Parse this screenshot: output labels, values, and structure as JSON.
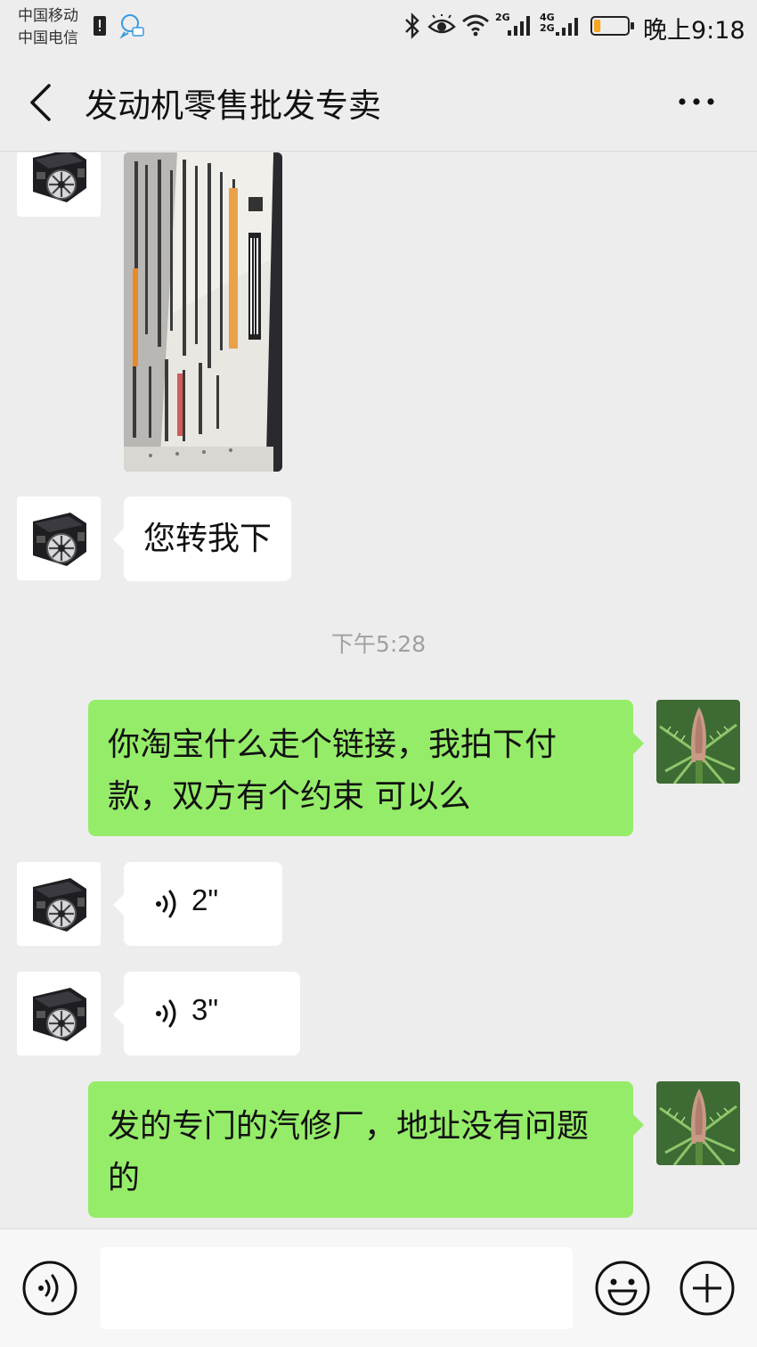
{
  "status_bar": {
    "carrier_1": "中国移动",
    "carrier_2": "中国电信",
    "signal_1_label": "2G",
    "signal_2_label_top": "4G",
    "signal_2_label_bottom": "2G",
    "time": "晚上9:18",
    "battery_level": 0.2,
    "icons": [
      "sim-alert-icon",
      "notification-bubble-icon",
      "bluetooth-icon",
      "eye-comfort-icon",
      "wifi-icon",
      "signal-icon",
      "battery-icon"
    ]
  },
  "header": {
    "title": "发动机零售批发专卖",
    "back_icon": "chevron-left-icon",
    "more_icon": "more-dots-icon"
  },
  "messages": [
    {
      "from": "contact",
      "type": "image",
      "avatar": "engine-avatar"
    },
    {
      "from": "contact",
      "type": "text",
      "text": "您转我下"
    },
    {
      "type": "timestamp",
      "text": "下午5:28"
    },
    {
      "from": "me",
      "type": "text",
      "text": "你淘宝什么走个链接，我拍下付款，双方有个约束 可以么"
    },
    {
      "from": "contact",
      "type": "voice",
      "duration": "2\""
    },
    {
      "from": "contact",
      "type": "voice",
      "duration": "3\""
    },
    {
      "from": "me",
      "type": "text",
      "text": "发的专门的汽修厂，地址没有问题的"
    }
  ],
  "input_bar": {
    "placeholder": "",
    "voice_icon": "voice-input-icon",
    "emoji_icon": "emoji-icon",
    "plus_icon": "plus-icon"
  },
  "colors": {
    "background": "#ededed",
    "my_bubble": "#95ec69",
    "their_bubble": "#ffffff",
    "timestamp": "#a0a0a0"
  }
}
